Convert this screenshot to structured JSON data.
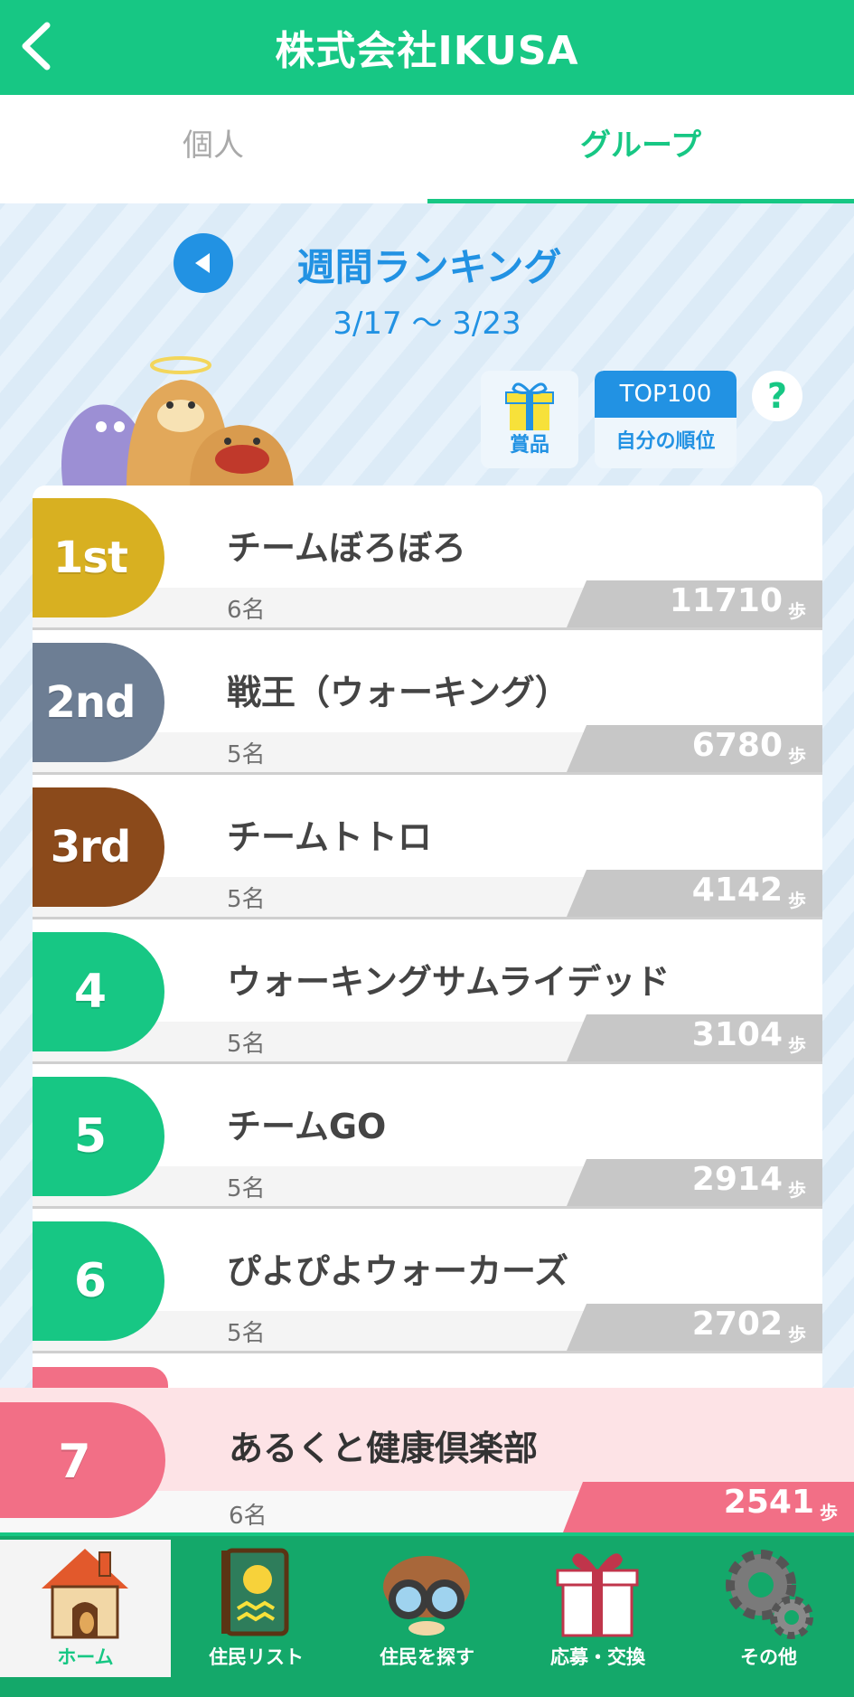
{
  "header": {
    "title": "株式会社IKUSA"
  },
  "tabs": {
    "individual": "個人",
    "group": "グループ"
  },
  "ranking": {
    "title": "週間ランキング",
    "date_range": "3/17 〜 3/23"
  },
  "actions": {
    "prize_label": "賞品",
    "top100_label": "TOP100",
    "my_rank_label": "自分の順位",
    "help_label": "?"
  },
  "colors": {
    "accent": "#17c784",
    "blue": "#2292e3",
    "gold": "#d8b021",
    "silver": "#6d7e94",
    "bronze": "#8b4a1b",
    "green_rank": "#17c784",
    "my_team": "#f26f86"
  },
  "list": [
    {
      "rank": "1st",
      "name": "チームぼろぼろ",
      "members": "6名",
      "steps": "11710",
      "unit": "歩"
    },
    {
      "rank": "2nd",
      "name": "戦王（ウォーキング）",
      "members": "5名",
      "steps": "6780",
      "unit": "歩"
    },
    {
      "rank": "3rd",
      "name": "チームトトロ",
      "members": "5名",
      "steps": "4142",
      "unit": "歩"
    },
    {
      "rank": "4",
      "name": "ウォーキングサムライデッド",
      "members": "5名",
      "steps": "3104",
      "unit": "歩"
    },
    {
      "rank": "5",
      "name": "チームGO",
      "members": "5名",
      "steps": "2914",
      "unit": "歩"
    },
    {
      "rank": "6",
      "name": "ぴよぴよウォーカーズ",
      "members": "5名",
      "steps": "2702",
      "unit": "歩"
    }
  ],
  "my_team": {
    "rank": "7",
    "name": "あるくと健康倶楽部",
    "members": "6名",
    "steps": "2541",
    "unit": "歩"
  },
  "nav": [
    {
      "label": "ホーム",
      "icon": "house-icon"
    },
    {
      "label": "住民リスト",
      "icon": "book-icon"
    },
    {
      "label": "住民を探す",
      "icon": "binoculars-icon"
    },
    {
      "label": "応募・交換",
      "icon": "gift-icon"
    },
    {
      "label": "その他",
      "icon": "gear-icon"
    }
  ]
}
